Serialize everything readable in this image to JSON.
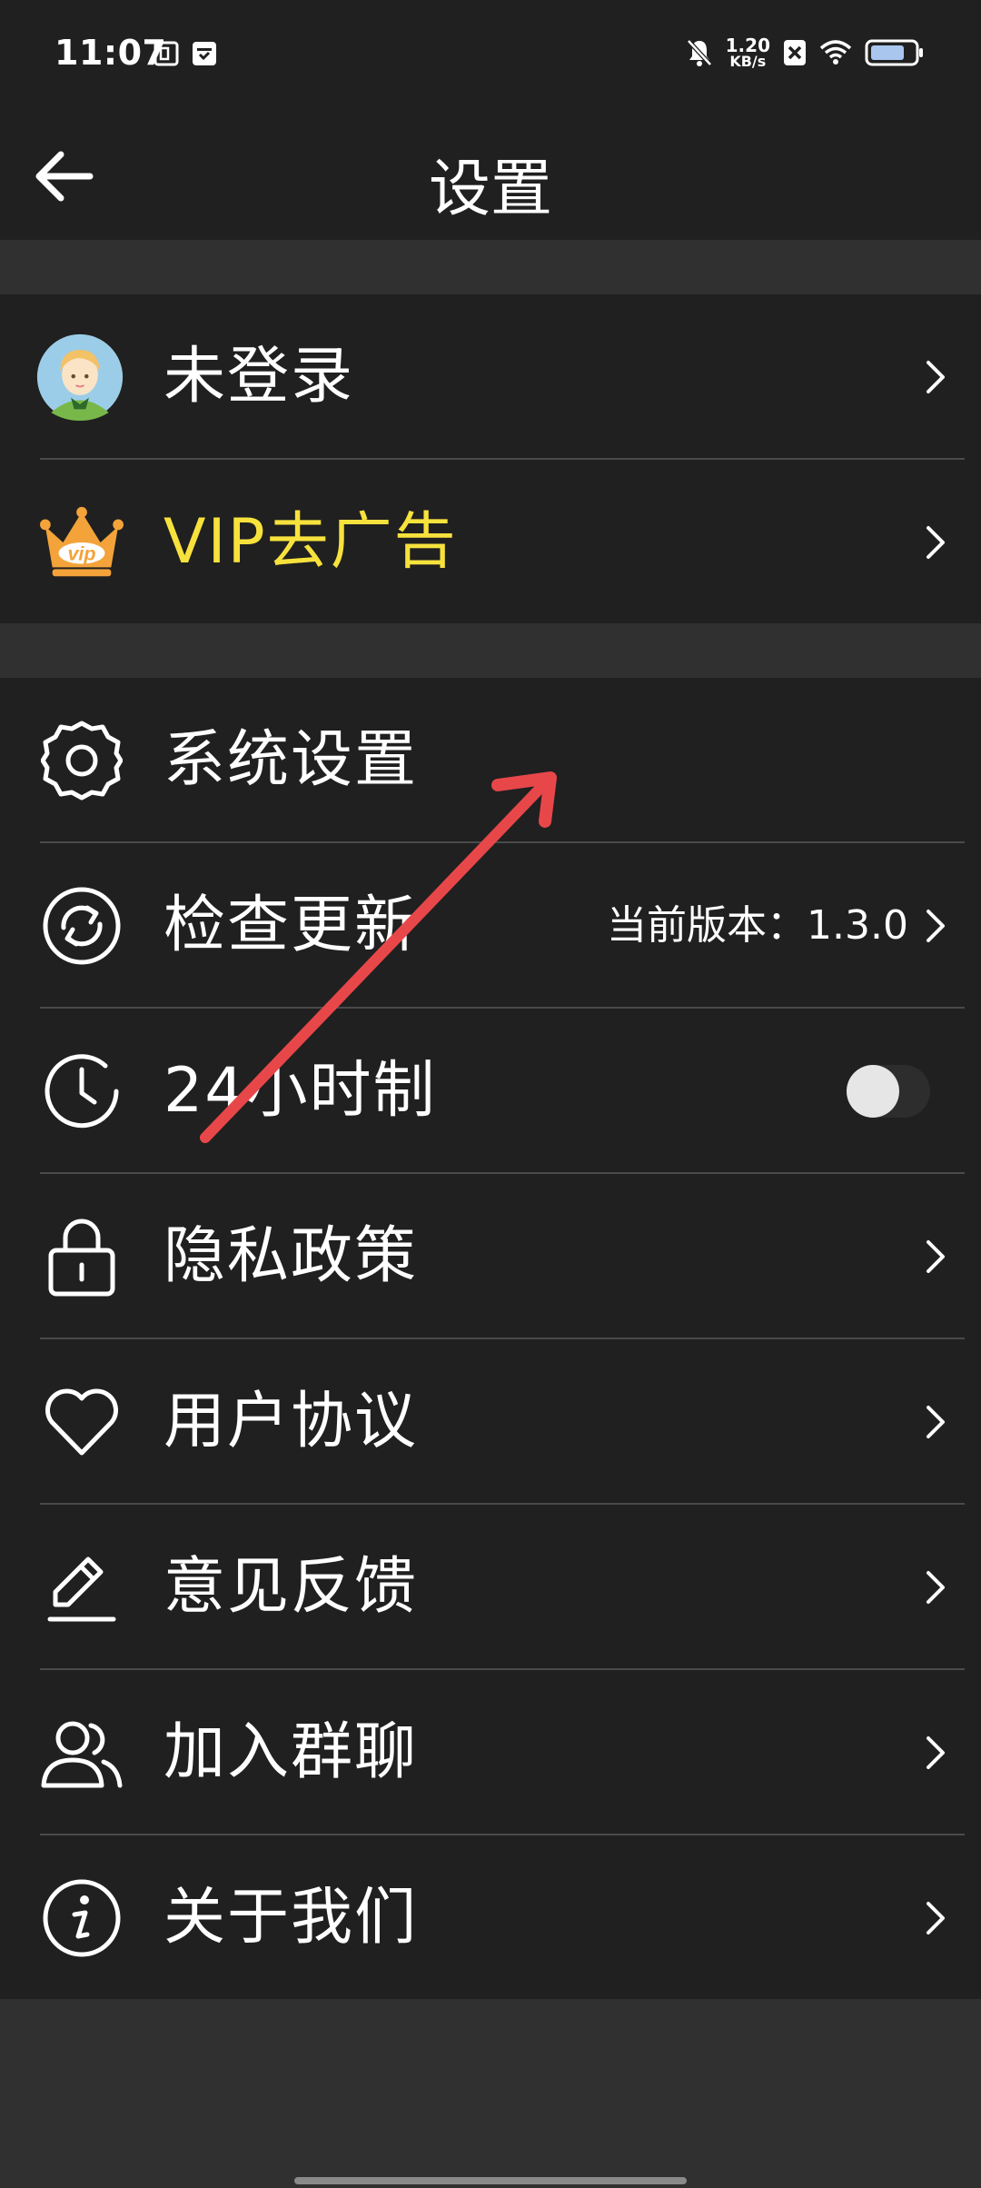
{
  "status_bar": {
    "time": "11:07",
    "net_speed_value": "1.20",
    "net_speed_unit": "KB/s"
  },
  "header": {
    "title": "设置"
  },
  "account_group": [
    {
      "label": "未登录",
      "icon": "avatar-icon"
    },
    {
      "label": "VIP去广告",
      "icon": "vip-crown-icon",
      "accent": "#f7e23d"
    }
  ],
  "settings_group": [
    {
      "label": "系统设置",
      "icon": "gear-icon"
    },
    {
      "label": "检查更新",
      "icon": "refresh-icon",
      "right_text": "当前版本：1.3.0"
    },
    {
      "label": "24小时制",
      "icon": "clock-icon",
      "toggle_on": false
    },
    {
      "label": "隐私政策",
      "icon": "lock-icon"
    },
    {
      "label": "用户协议",
      "icon": "heart-icon"
    },
    {
      "label": "意见反馈",
      "icon": "pencil-icon"
    },
    {
      "label": "加入群聊",
      "icon": "users-icon"
    },
    {
      "label": "关于我们",
      "icon": "info-icon"
    }
  ],
  "colors": {
    "background": "#303030",
    "panel": "#202020",
    "divider": "#4a4a4a",
    "vip_accent": "#f7e23d",
    "annotation_arrow": "#e8474a"
  }
}
